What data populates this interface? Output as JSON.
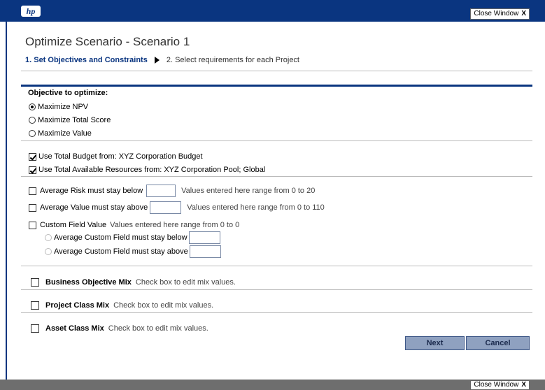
{
  "header": {
    "logo_text": "hp",
    "close_label": "Close Window",
    "close_x": "X"
  },
  "footer": {
    "close_label": "Close Window",
    "close_x": "X"
  },
  "page_title": "Optimize Scenario - Scenario 1",
  "steps": {
    "step1": "1. Set Objectives and Constraints",
    "step2": "2. Select requirements for each Project"
  },
  "objective": {
    "heading": "Objective to optimize:",
    "options": [
      {
        "label": "Maximize NPV",
        "checked": true
      },
      {
        "label": "Maximize Total Score",
        "checked": false
      },
      {
        "label": "Maximize Value",
        "checked": false
      }
    ]
  },
  "budget": {
    "label": "Use Total Budget from: XYZ Corporation Budget",
    "checked": true
  },
  "resources": {
    "label": "Use Total Available Resources from: XYZ Corporation Pool; Global",
    "checked": true
  },
  "constraints": {
    "risk": {
      "label": "Average Risk must stay below",
      "value": "",
      "hint": "Values entered here range from 0 to 20"
    },
    "value": {
      "label": "Average Value must stay above",
      "value": "",
      "hint": "Values entered here range from 0 to 110"
    },
    "custom": {
      "label": "Custom Field Value",
      "hint": "Values entered here range from 0 to 0"
    },
    "custom_below": {
      "label": "Average Custom Field must stay below",
      "value": ""
    },
    "custom_above": {
      "label": "Average Custom Field must stay above",
      "value": ""
    }
  },
  "mixes": [
    {
      "label": "Business Objective Mix",
      "hint": "Check box to edit mix values."
    },
    {
      "label": "Project Class Mix",
      "hint": "Check box to edit mix values."
    },
    {
      "label": "Asset Class Mix",
      "hint": "Check box to edit mix values."
    }
  ],
  "buttons": {
    "next": "Next",
    "cancel": "Cancel"
  },
  "colors": {
    "brand": "#0a3580",
    "button_bg": "#8fa1c0",
    "footer": "#6e6e6e"
  }
}
